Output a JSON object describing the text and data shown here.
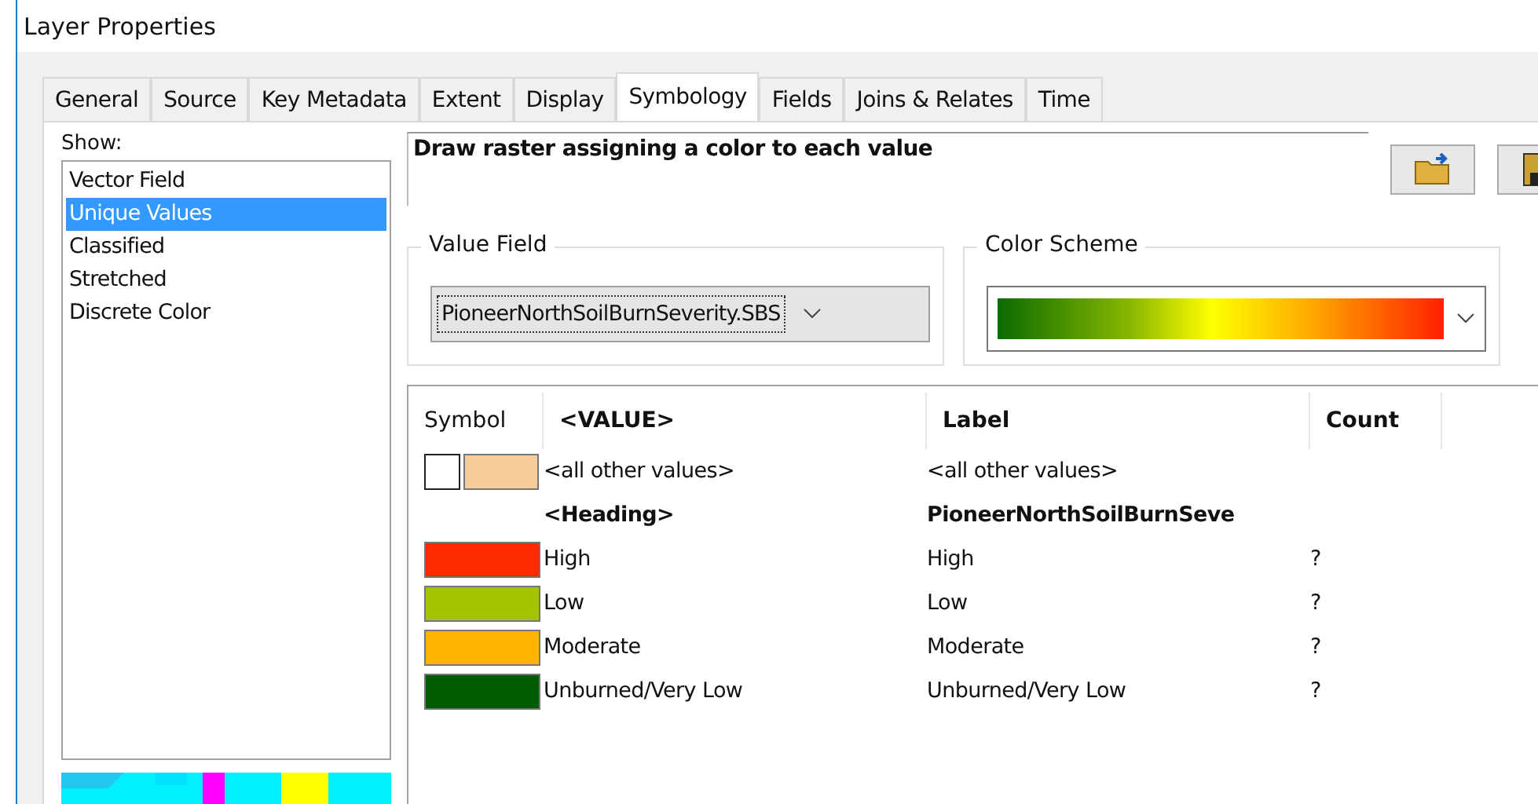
{
  "window": {
    "title": "Layer Properties"
  },
  "tabs": [
    {
      "label": "General",
      "selected": false
    },
    {
      "label": "Source",
      "selected": false
    },
    {
      "label": "Key Metadata",
      "selected": false
    },
    {
      "label": "Extent",
      "selected": false
    },
    {
      "label": "Display",
      "selected": false
    },
    {
      "label": "Symbology",
      "selected": true
    },
    {
      "label": "Fields",
      "selected": false
    },
    {
      "label": "Joins & Relates",
      "selected": false
    },
    {
      "label": "Time",
      "selected": false
    }
  ],
  "show": {
    "label": "Show:",
    "items": [
      {
        "label": "Vector Field",
        "selected": false
      },
      {
        "label": "Unique Values",
        "selected": true
      },
      {
        "label": "Classified",
        "selected": false
      },
      {
        "label": "Stretched",
        "selected": false
      },
      {
        "label": "Discrete Color",
        "selected": false
      }
    ]
  },
  "description": "Draw raster assigning a color to each value",
  "value_field": {
    "label": "Value Field",
    "value": "PioneerNorthSoilBurnSeverity.SBS"
  },
  "color_scheme": {
    "label": "Color Scheme"
  },
  "table": {
    "columns": [
      "Symbol",
      "<VALUE>",
      "Label",
      "Count"
    ],
    "rows": [
      {
        "kind": "default",
        "color": "#f5cc9a",
        "value": "<all other values>",
        "label": "<all other values>"
      },
      {
        "kind": "heading",
        "value": "<Heading>",
        "label": "PioneerNorthSoilBurnSeve"
      },
      {
        "kind": "class",
        "color": "#ff2a00",
        "value": "High",
        "label": "High",
        "count": "?"
      },
      {
        "kind": "class",
        "color": "#a3c400",
        "value": "Low",
        "label": "Low",
        "count": "?"
      },
      {
        "kind": "class",
        "color": "#ffb400",
        "value": "Moderate",
        "label": "Moderate",
        "count": "?"
      },
      {
        "kind": "class",
        "color": "#005c00",
        "value": "Unburned/Very Low",
        "label": "Unburned/Very Low",
        "count": "?"
      }
    ]
  }
}
